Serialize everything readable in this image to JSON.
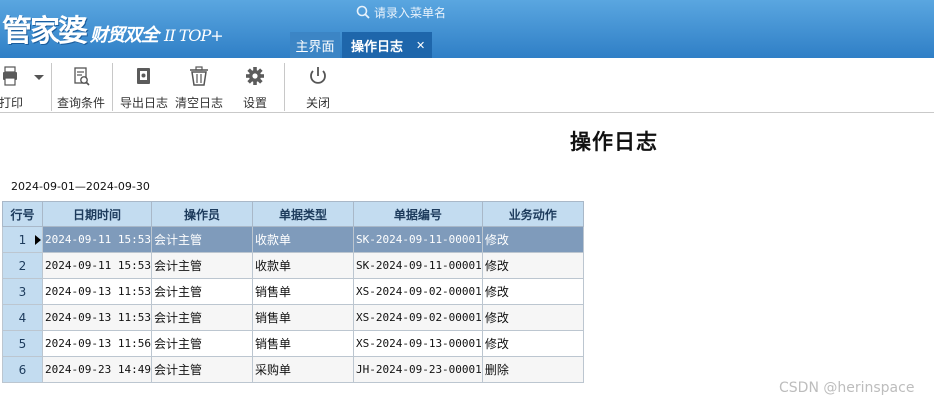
{
  "header": {
    "logo_main": "管家婆",
    "logo_sub": "财贸双全",
    "logo_version": "II TOP+",
    "search_placeholder": "请录入菜单名",
    "tabs": [
      {
        "label": "主界面"
      },
      {
        "label": "操作日志"
      }
    ],
    "tab_close": "✕"
  },
  "toolbar": {
    "items": [
      {
        "label": "打印",
        "icon": "printer-icon"
      },
      {
        "label": "查询条件",
        "icon": "query-icon"
      },
      {
        "label": "导出日志",
        "icon": "export-icon"
      },
      {
        "label": "清空日志",
        "icon": "trash-icon"
      },
      {
        "label": "设置",
        "icon": "gear-icon"
      },
      {
        "label": "关闭",
        "icon": "power-icon"
      }
    ]
  },
  "report": {
    "title": "操作日志",
    "date_range": "2024-09-01—2024-09-30"
  },
  "table": {
    "columns": [
      "行号",
      "日期时间",
      "操作员",
      "单据类型",
      "单据编号",
      "业务动作"
    ],
    "rows": [
      {
        "no": "1",
        "datetime": "2024-09-11 15:53",
        "operator": "会计主管",
        "doc_type": "收款单",
        "doc_no": "SK-2024-09-11-00001",
        "action": "修改"
      },
      {
        "no": "2",
        "datetime": "2024-09-11 15:53",
        "operator": "会计主管",
        "doc_type": "收款单",
        "doc_no": "SK-2024-09-11-00001",
        "action": "修改"
      },
      {
        "no": "3",
        "datetime": "2024-09-13 11:53",
        "operator": "会计主管",
        "doc_type": "销售单",
        "doc_no": "XS-2024-09-02-00001",
        "action": "修改"
      },
      {
        "no": "4",
        "datetime": "2024-09-13 11:53",
        "operator": "会计主管",
        "doc_type": "销售单",
        "doc_no": "XS-2024-09-02-00001",
        "action": "修改"
      },
      {
        "no": "5",
        "datetime": "2024-09-13 11:56",
        "operator": "会计主管",
        "doc_type": "销售单",
        "doc_no": "XS-2024-09-13-00001",
        "action": "修改"
      },
      {
        "no": "6",
        "datetime": "2024-09-23 14:49",
        "operator": "会计主管",
        "doc_type": "采购单",
        "doc_no": "JH-2024-09-23-00001",
        "action": "删除"
      }
    ],
    "selected_row": 1
  },
  "watermark": "CSDN @herinspace",
  "colors": {
    "header": "#2f7fc6",
    "active_tab": "#1e66ab",
    "selected_row": "#7f9bbb",
    "table_header": "#c3dcf0"
  }
}
